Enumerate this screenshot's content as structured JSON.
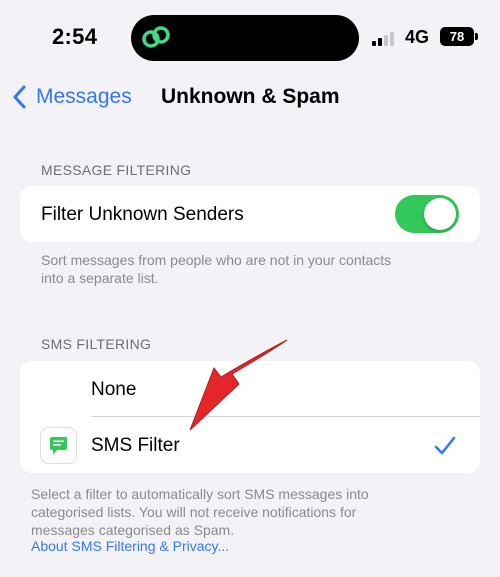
{
  "status_bar": {
    "time": "2:54",
    "network": "4G",
    "battery": "78"
  },
  "nav": {
    "back_label": "Messages",
    "title": "Unknown & Spam"
  },
  "message_filtering": {
    "header": "MESSAGE FILTERING",
    "toggle_label": "Filter Unknown Senders",
    "toggle_on": true,
    "footer_line1": "Sort messages from people who are not in your contacts",
    "footer_line2": "into a separate list."
  },
  "sms_filtering": {
    "header": "SMS FILTERING",
    "options": [
      {
        "label": "None",
        "selected": false
      },
      {
        "label": "SMS Filter",
        "selected": true
      }
    ],
    "footer_line1": "Select a filter to automatically sort SMS messages into",
    "footer_line2": "categorised lists. You will not receive notifications for",
    "footer_line3": "messages categorised as Spam.",
    "link": "About SMS Filtering & Privacy..."
  },
  "colors": {
    "accent": "#3478f6",
    "toggle_on": "#34c759",
    "annotation_arrow": "#e3262a"
  }
}
